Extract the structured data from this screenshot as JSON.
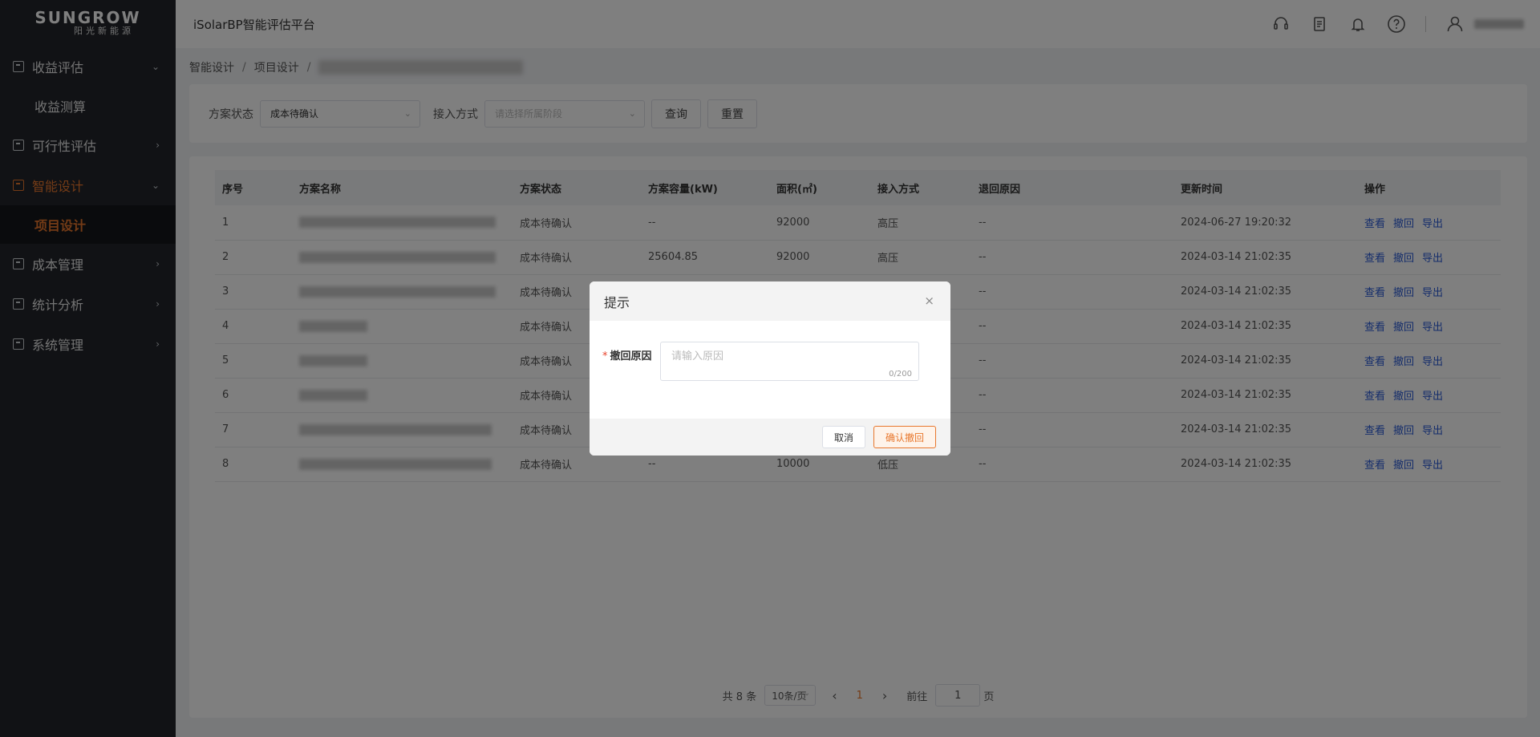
{
  "sidebar": {
    "logo_text": "SUNGROW",
    "logo_sub": "阳光新能源",
    "items": [
      {
        "label": "收益评估",
        "arrow": "⌄"
      },
      {
        "label": "收益测算"
      },
      {
        "label": "可行性评估",
        "arrow": "›"
      },
      {
        "label": "智能设计",
        "arrow": "⌄"
      },
      {
        "label": "项目设计"
      },
      {
        "label": "成本管理",
        "arrow": "›"
      },
      {
        "label": "统计分析",
        "arrow": "›"
      },
      {
        "label": "系统管理",
        "arrow": "›"
      }
    ]
  },
  "header": {
    "title": "iSolarBP智能评估平台",
    "icons": [
      "headset-icon",
      "document-icon",
      "bell-icon",
      "help-icon",
      "user-icon"
    ]
  },
  "breadcrumb": {
    "items": [
      "智能设计",
      "项目设计"
    ],
    "sep": "/"
  },
  "filter": {
    "status_label": "方案状态",
    "status_value": "成本待确认",
    "access_label": "接入方式",
    "access_placeholder": "请选择所属阶段",
    "query_label": "查询",
    "reset_label": "重置"
  },
  "table": {
    "headers": [
      "序号",
      "方案名称",
      "方案状态",
      "方案容量(kW)",
      "面积(㎡)",
      "接入方式",
      "退回原因",
      "更新时间",
      "操作"
    ],
    "rows": [
      {
        "no": "1",
        "status": "成本待确认",
        "capacity": "--",
        "area": "92000",
        "access": "高压",
        "reason": "--",
        "time": "2024-06-27 19:20:32"
      },
      {
        "no": "2",
        "status": "成本待确认",
        "capacity": "25604.85",
        "area": "92000",
        "access": "高压",
        "reason": "--",
        "time": "2024-03-14 21:02:35"
      },
      {
        "no": "3",
        "status": "成本待确认",
        "capacity": "",
        "area": "",
        "access": "",
        "reason": "--",
        "time": "2024-03-14 21:02:35"
      },
      {
        "no": "4",
        "status": "成本待确认",
        "capacity": "",
        "area": "",
        "access": "",
        "reason": "--",
        "time": "2024-03-14 21:02:35"
      },
      {
        "no": "5",
        "status": "成本待确认",
        "capacity": "",
        "area": "",
        "access": "",
        "reason": "--",
        "time": "2024-03-14 21:02:35"
      },
      {
        "no": "6",
        "status": "成本待确认",
        "capacity": "",
        "area": "",
        "access": "",
        "reason": "--",
        "time": "2024-03-14 21:02:35"
      },
      {
        "no": "7",
        "status": "成本待确认",
        "capacity": "",
        "area": "",
        "access": "",
        "reason": "--",
        "time": "2024-03-14 21:02:35"
      },
      {
        "no": "8",
        "status": "成本待确认",
        "capacity": "--",
        "area": "10000",
        "access": "低压",
        "reason": "--",
        "time": "2024-03-14 21:02:35"
      }
    ],
    "ops": [
      "查看",
      "撤回",
      "导出"
    ]
  },
  "pager": {
    "total": "共 8 条",
    "page_size": "10条/页",
    "prev": "‹",
    "current": "1",
    "next": "›",
    "goto_label": "前往",
    "goto_value": "1",
    "page_suffix": "页"
  },
  "dialog": {
    "title": "提示",
    "close": "×",
    "required_mark": "*",
    "label": "撤回原因",
    "placeholder": "请输入原因",
    "count": "0/200",
    "cancel": "取消",
    "confirm": "确认撤回"
  }
}
